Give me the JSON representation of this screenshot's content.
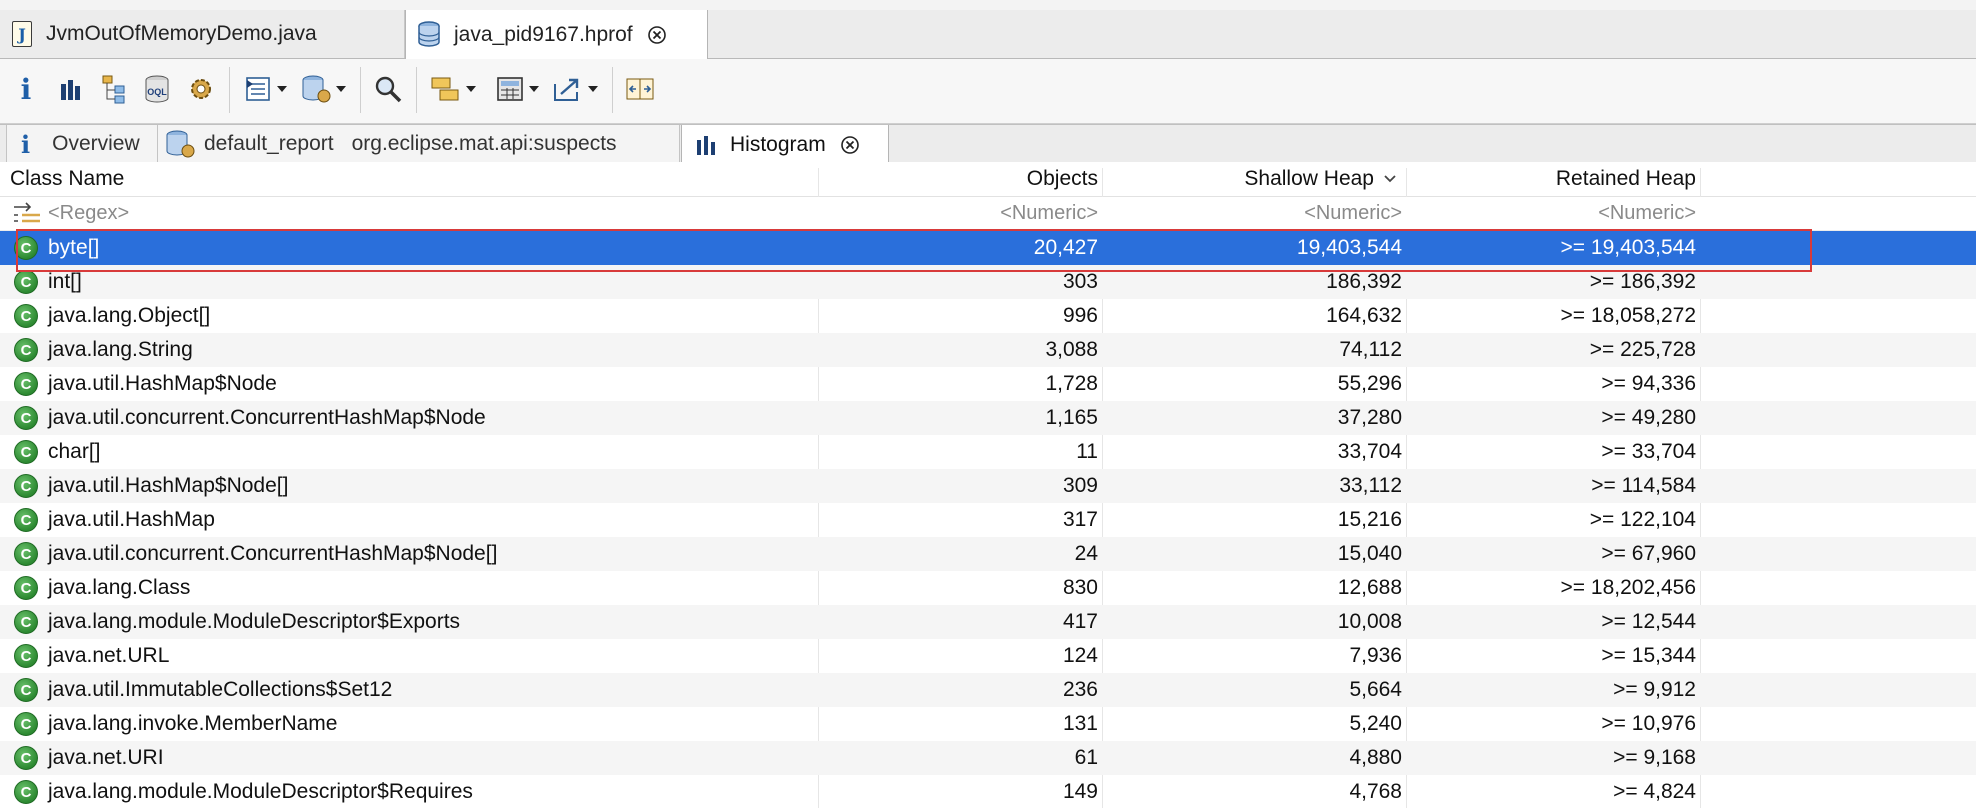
{
  "editor_tabs": [
    {
      "label": "JvmOutOfMemoryDemo.java",
      "icon": "java-file-icon"
    },
    {
      "label": "java_pid9167.hprof",
      "icon": "heap-dump-icon",
      "active": true
    }
  ],
  "toolbar": {
    "icons": [
      "info-icon",
      "histogram-icon",
      "dominator-tree-icon",
      "oql-icon",
      "gear-icon",
      "query-browser-icon",
      "heap-dump-history-icon",
      "search-icon",
      "group-icon",
      "calculator-icon",
      "export-icon",
      "compare-icon"
    ],
    "oql_label": "OQL"
  },
  "inner_tabs": [
    {
      "label": "Overview"
    },
    {
      "label": "default_report",
      "extra": "org.eclipse.mat.api:suspects"
    },
    {
      "label": "Histogram",
      "active": true
    }
  ],
  "table": {
    "columns": [
      "Class Name",
      "Objects",
      "Shallow Heap",
      "Retained Heap"
    ],
    "filters": [
      "<Regex>",
      "<Numeric>",
      "<Numeric>",
      "<Numeric>"
    ],
    "rows": [
      {
        "name": "byte[]",
        "objects": "20,427",
        "shallow": "19,403,544",
        "retained": ">= 19,403,544",
        "selected": true
      },
      {
        "name": "int[]",
        "objects": "303",
        "shallow": "186,392",
        "retained": ">= 186,392"
      },
      {
        "name": "java.lang.Object[]",
        "objects": "996",
        "shallow": "164,632",
        "retained": ">= 18,058,272"
      },
      {
        "name": "java.lang.String",
        "objects": "3,088",
        "shallow": "74,112",
        "retained": ">= 225,728"
      },
      {
        "name": "java.util.HashMap$Node",
        "objects": "1,728",
        "shallow": "55,296",
        "retained": ">= 94,336"
      },
      {
        "name": "java.util.concurrent.ConcurrentHashMap$Node",
        "objects": "1,165",
        "shallow": "37,280",
        "retained": ">= 49,280"
      },
      {
        "name": "char[]",
        "objects": "11",
        "shallow": "33,704",
        "retained": ">= 33,704"
      },
      {
        "name": "java.util.HashMap$Node[]",
        "objects": "309",
        "shallow": "33,112",
        "retained": ">= 114,584"
      },
      {
        "name": "java.util.HashMap",
        "objects": "317",
        "shallow": "15,216",
        "retained": ">= 122,104"
      },
      {
        "name": "java.util.concurrent.ConcurrentHashMap$Node[]",
        "objects": "24",
        "shallow": "15,040",
        "retained": ">= 67,960"
      },
      {
        "name": "java.lang.Class",
        "objects": "830",
        "shallow": "12,688",
        "retained": ">= 18,202,456"
      },
      {
        "name": "java.lang.module.ModuleDescriptor$Exports",
        "objects": "417",
        "shallow": "10,008",
        "retained": ">= 12,544"
      },
      {
        "name": "java.net.URL",
        "objects": "124",
        "shallow": "7,936",
        "retained": ">= 15,344"
      },
      {
        "name": "java.util.ImmutableCollections$Set12",
        "objects": "236",
        "shallow": "5,664",
        "retained": ">= 9,912"
      },
      {
        "name": "java.lang.invoke.MemberName",
        "objects": "131",
        "shallow": "5,240",
        "retained": ">= 10,976"
      },
      {
        "name": "java.net.URI",
        "objects": "61",
        "shallow": "4,880",
        "retained": ">= 9,168"
      },
      {
        "name": "java.lang.module.ModuleDescriptor$Requires",
        "objects": "149",
        "shallow": "4,768",
        "retained": ">= 4,824"
      }
    ]
  },
  "colors": {
    "selection": "#2a6fdb",
    "highlight": "#d83a3a",
    "class_icon": "#2d8a32"
  }
}
